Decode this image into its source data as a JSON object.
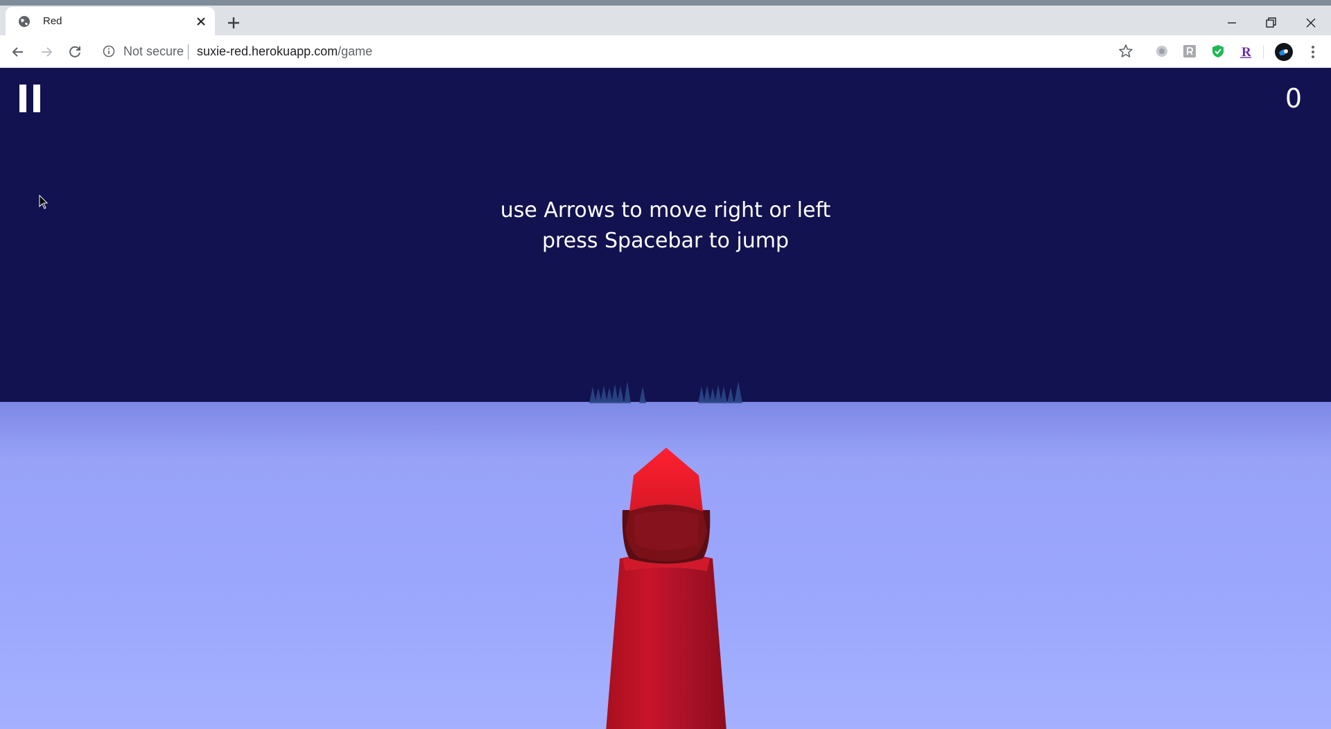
{
  "browser": {
    "tab": {
      "title": "Red",
      "favicon": "globe-icon",
      "close": "close-icon"
    },
    "new_tab": "plus-icon",
    "window_controls": [
      "minimize-icon",
      "restore-icon",
      "close-icon"
    ],
    "toolbar": {
      "back": "back-arrow-icon",
      "forward": "forward-arrow-icon",
      "reload": "reload-icon",
      "security_label": "Not secure",
      "url_host": "suxie-red.herokuapp.com",
      "url_path": "/game",
      "bookmark": "star-icon",
      "extensions": [
        "extension-gray-icon",
        "extension-r-box-icon",
        "shield-check-icon",
        "r-letter-icon"
      ],
      "profile": "avatar-icon",
      "menu": "kebab-menu-icon"
    }
  },
  "game": {
    "pause": "pause-icon",
    "score": "0",
    "instruction_line1": "use Arrows to move right or left",
    "instruction_line2": "press Spacebar to jump",
    "colors": {
      "sky": "#121250",
      "ground": "#9aa6fc",
      "character": "#d3162b",
      "trees": "#2c4b8a"
    }
  }
}
